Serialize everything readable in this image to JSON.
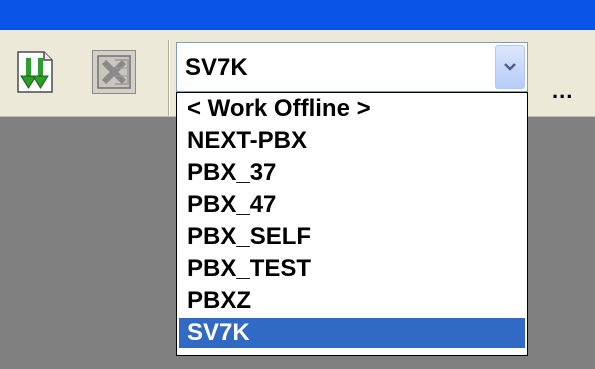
{
  "toolbar": {
    "sort_icon": "green-down-arrows-icon",
    "excel_icon": "excel-icon",
    "more_label": "..."
  },
  "pbx_select": {
    "selected": "SV7K",
    "options": [
      "< Work Offline >",
      "NEXT-PBX",
      "PBX_37",
      "PBX_47",
      "PBX_SELF",
      "PBX_TEST",
      "PBXZ",
      "SV7K"
    ],
    "highlight_color": "#316ac5"
  },
  "colors": {
    "titlebar": "#0a55e8",
    "toolbar_bg": "#ece9d8",
    "workspace_bg": "#808080"
  }
}
